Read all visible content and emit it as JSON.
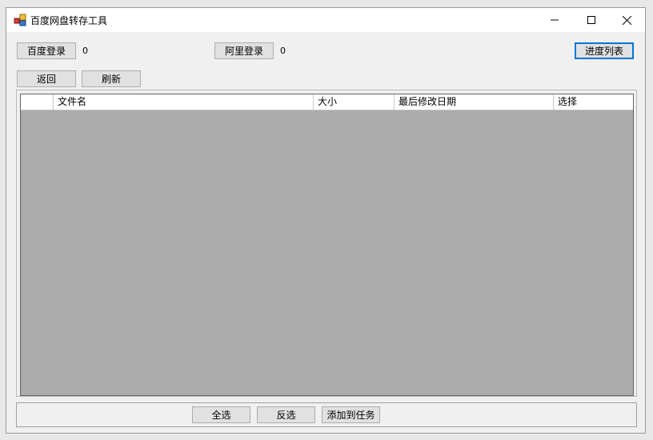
{
  "window": {
    "title": "百度网盘转存工具",
    "minimize_glyph": "─",
    "maximize_glyph": "☐",
    "close_glyph": "✕"
  },
  "toolbar": {
    "baidu_login": "百度登录",
    "baidu_count": "0",
    "ali_login": "阿里登录",
    "ali_count": "0",
    "progress_list": "进度列表",
    "back": "返回",
    "refresh": "刷新"
  },
  "grid": {
    "columns": [
      "",
      "文件名",
      "大小",
      "最后修改日期",
      "选择"
    ],
    "rows": []
  },
  "footer": {
    "select_all": "全选",
    "invert_selection": "反选",
    "add_to_task": "添加到任务"
  },
  "colors": {
    "accent": "#0078d7",
    "grid_background": "#ababab",
    "button_face": "#e1e1e1"
  }
}
